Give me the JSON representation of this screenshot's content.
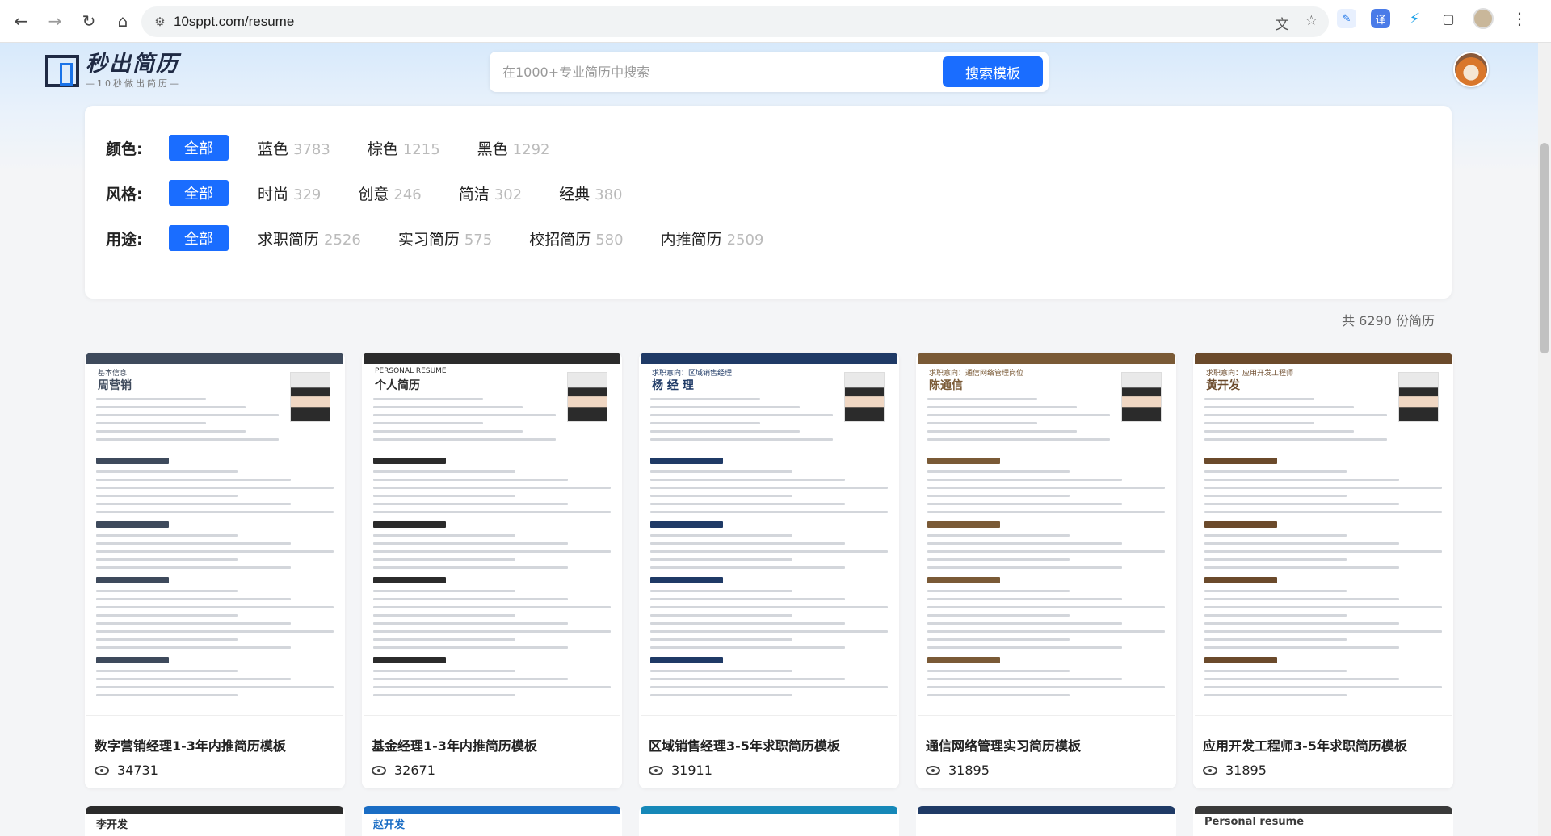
{
  "browser": {
    "url": "10sppt.com/resume"
  },
  "header": {
    "logo_title": "秒出简历",
    "logo_subtitle": "—10秒做出简历—",
    "search_placeholder": "在1000+专业简历中搜索",
    "search_button": "搜索模板"
  },
  "filters": [
    {
      "label": "颜色:",
      "all": "全部",
      "options": [
        {
          "name": "蓝色",
          "count": "3783"
        },
        {
          "name": "棕色",
          "count": "1215"
        },
        {
          "name": "黑色",
          "count": "1292"
        }
      ]
    },
    {
      "label": "风格:",
      "all": "全部",
      "options": [
        {
          "name": "时尚",
          "count": "329"
        },
        {
          "name": "创意",
          "count": "246"
        },
        {
          "name": "简洁",
          "count": "302"
        },
        {
          "name": "经典",
          "count": "380"
        }
      ]
    },
    {
      "label": "用途:",
      "all": "全部",
      "options": [
        {
          "name": "求职简历",
          "count": "2526"
        },
        {
          "name": "实习简历",
          "count": "575"
        },
        {
          "name": "校招简历",
          "count": "580"
        },
        {
          "name": "内推简历",
          "count": "2509"
        }
      ]
    }
  ],
  "total_label": "共 6290 份简历",
  "cards": [
    {
      "title": "数字营销经理1-3年内推简历模板",
      "views": "34731",
      "thumb_name": "周营销",
      "thumb_header": "基本信息",
      "accent": "#3e4a5c"
    },
    {
      "title": "基金经理1-3年内推简历模板",
      "views": "32671",
      "thumb_name": "个人简历",
      "thumb_header": "PERSONAL RESUME",
      "accent": "#2b2b2b"
    },
    {
      "title": "区域销售经理3-5年求职简历模板",
      "views": "31911",
      "thumb_name": "杨 经 理",
      "thumb_header": "求职意向：区域销售经理",
      "accent": "#1f3a66"
    },
    {
      "title": "通信网络管理实习简历模板",
      "views": "31895",
      "thumb_name": "陈通信",
      "thumb_header": "求职意向：通信网络管理岗位",
      "accent": "#7a5a36"
    },
    {
      "title": "应用开发工程师3-5年求职简历模板",
      "views": "31895",
      "thumb_name": "黄开发",
      "thumb_header": "求职意向：应用开发工程师",
      "accent": "#6b4a2b"
    }
  ],
  "row2_thumbs": [
    {
      "name": "李开发",
      "accent": "#2b2b2b"
    },
    {
      "name": "赵开发",
      "accent": "#1a6dc4"
    },
    {
      "name": "",
      "accent": "#1688b8"
    },
    {
      "name": "",
      "accent": "#1f3a66"
    },
    {
      "name": "Personal resume",
      "accent": "#3a3a3a"
    }
  ]
}
